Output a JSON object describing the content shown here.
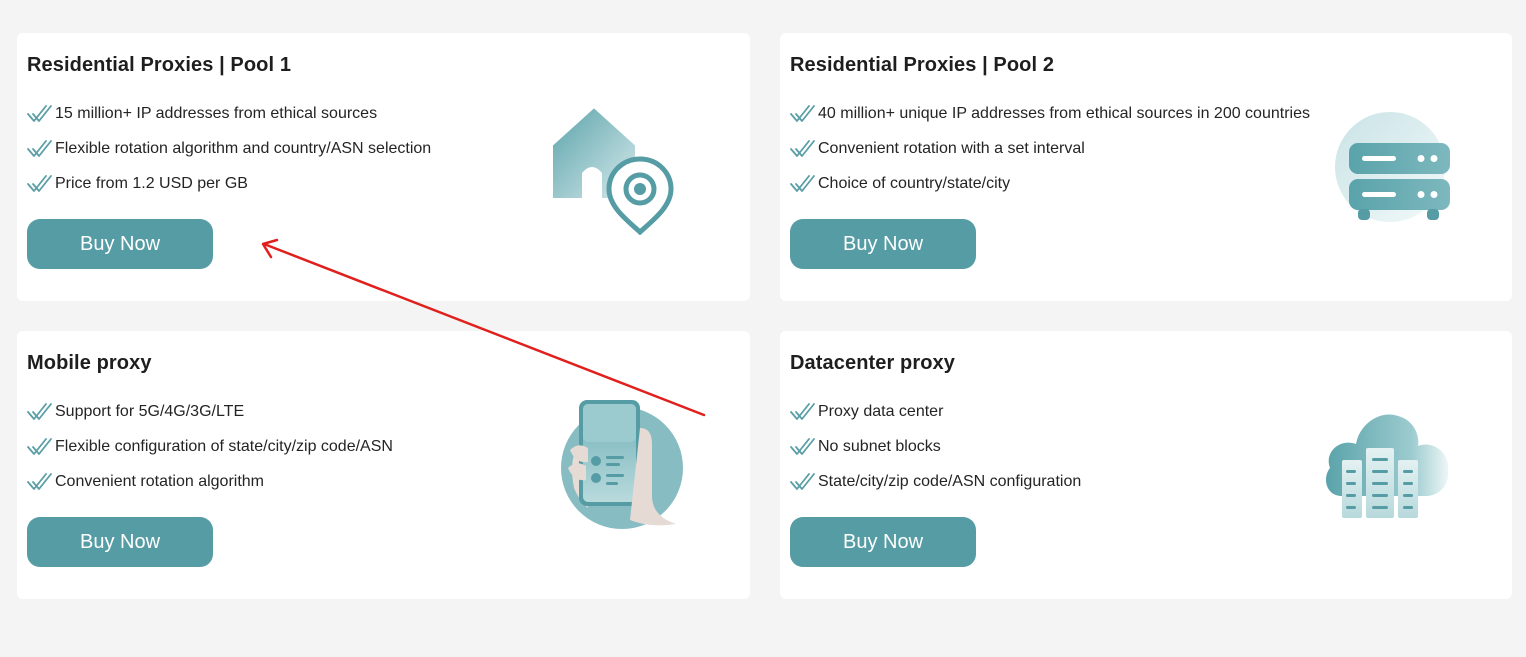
{
  "cards": [
    {
      "title": "Residential Proxies | Pool 1",
      "features": [
        "15 million+ IP addresses from ethical sources",
        "Flexible rotation algorithm and country/ASN selection",
        "Price from 1.2 USD per GB"
      ],
      "button_label": "Buy Now",
      "illustration": "house-location-pin-icon"
    },
    {
      "title": "Residential Proxies | Pool 2",
      "features": [
        "40 million+ unique IP addresses from ethical sources in 200 countries",
        "Convenient rotation with a set interval",
        "Choice of country/state/city"
      ],
      "button_label": "Buy Now",
      "illustration": "server-rack-icon"
    },
    {
      "title": "Mobile proxy",
      "features": [
        "Support for 5G/4G/3G/LTE",
        "Flexible configuration of state/city/zip code/ASN",
        "Convenient rotation algorithm"
      ],
      "button_label": "Buy Now",
      "illustration": "hand-holding-phone-icon"
    },
    {
      "title": "Datacenter proxy",
      "features": [
        "Proxy data center",
        "No subnet blocks",
        "State/city/zip code/ASN configuration"
      ],
      "button_label": "Buy Now",
      "illustration": "cloud-buildings-icon"
    }
  ],
  "colors": {
    "background": "#f4f4f4",
    "card": "#ffffff",
    "accent": "#559ca4",
    "check": "#5a9ea6",
    "annotation_arrow": "#e0201c"
  },
  "annotation": {
    "type": "arrow",
    "points_to": "cards.0.button"
  }
}
